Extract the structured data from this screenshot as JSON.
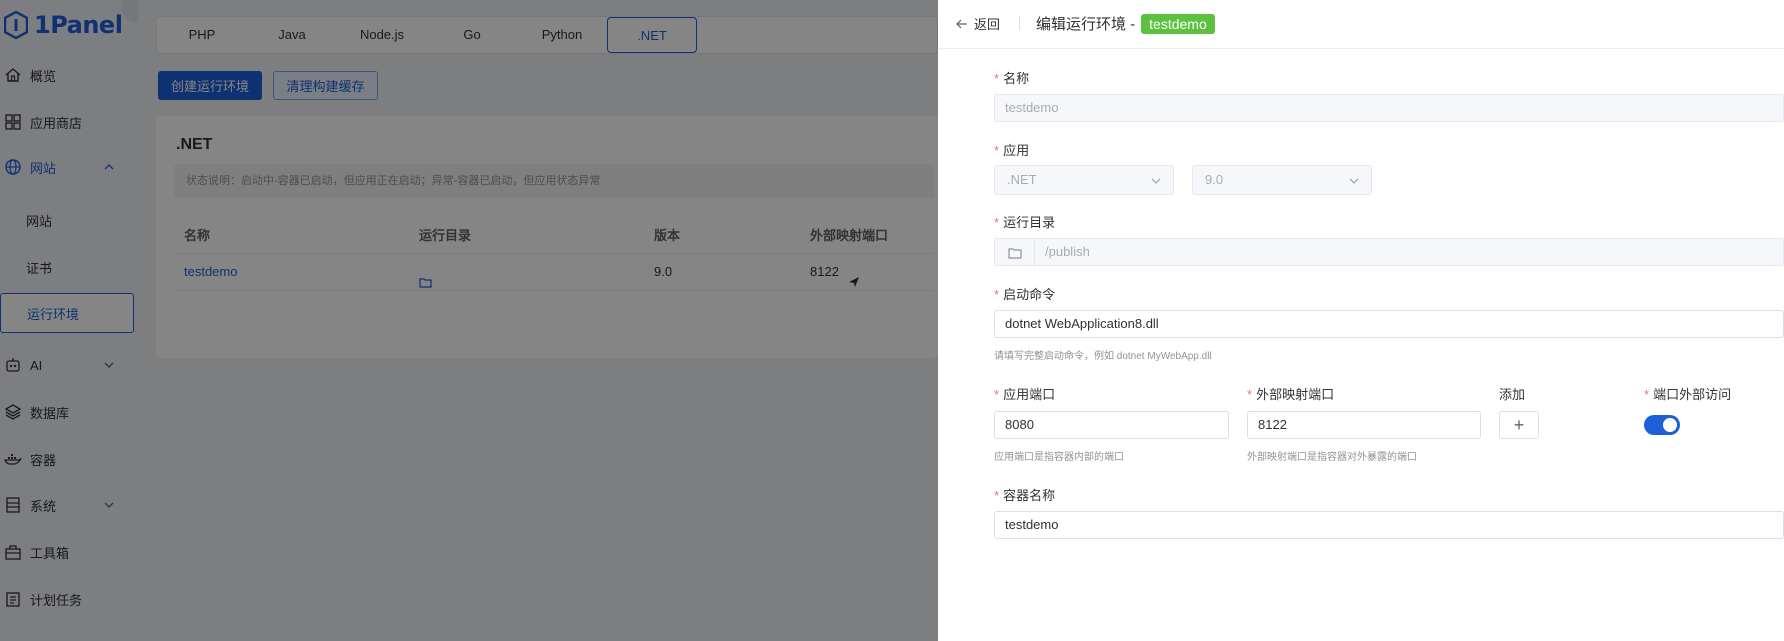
{
  "app": {
    "logo_text": "1Panel"
  },
  "sidebar": {
    "items": [
      {
        "label": "概览",
        "icon": "home-icon"
      },
      {
        "label": "应用商店",
        "icon": "grid-icon"
      },
      {
        "label": "网站",
        "icon": "globe-icon",
        "expanded": true
      },
      {
        "label": "AI",
        "icon": "robot-icon"
      },
      {
        "label": "数据库",
        "icon": "layers-icon"
      },
      {
        "label": "容器",
        "icon": "docker-icon"
      },
      {
        "label": "系统",
        "icon": "server-icon"
      },
      {
        "label": "工具箱",
        "icon": "toolbox-icon"
      },
      {
        "label": "计划任务",
        "icon": "calendar-icon"
      }
    ],
    "subitems": [
      {
        "label": "网站"
      },
      {
        "label": "证书"
      },
      {
        "label": "运行环境",
        "selected": true
      }
    ]
  },
  "tabs": [
    {
      "label": "PHP"
    },
    {
      "label": "Java"
    },
    {
      "label": "Node.js"
    },
    {
      "label": "Go"
    },
    {
      "label": "Python"
    },
    {
      "label": ".NET",
      "active": true
    }
  ],
  "actions": {
    "create_label": "创建运行环境",
    "clear_label": "清理构建缓存"
  },
  "card": {
    "title": ".NET",
    "status_tip": "状态说明：启动中-容器已启动，但应用正在启动；异常-容器已启动，但应用状态异常",
    "columns": [
      "名称",
      "运行目录",
      "版本",
      "外部映射端口"
    ],
    "rows": [
      {
        "name": "testdemo",
        "version": "9.0",
        "port": "8122"
      }
    ]
  },
  "drawer": {
    "back_label": "返回",
    "title": "编辑运行环境 -",
    "title_tag": "testdemo",
    "fields": {
      "name": {
        "label": "名称",
        "value": "testdemo"
      },
      "app": {
        "label": "应用",
        "app_value": ".NET",
        "version_value": "9.0"
      },
      "run_dir": {
        "label": "运行目录",
        "value": "/publish"
      },
      "command": {
        "label": "启动命令",
        "value": "dotnet WebApplication8.dll",
        "help": "请填写完整启动命令，例如 dotnet MyWebApp.dll"
      },
      "app_port": {
        "label": "应用端口",
        "value": "8080",
        "help": "应用端口是指容器内部的端口"
      },
      "ext_port": {
        "label": "外部映射端口",
        "value": "8122",
        "help": "外部映射端口是指容器对外暴露的端口"
      },
      "add": {
        "label": "添加",
        "button": "+"
      },
      "external_access": {
        "label": "端口外部访问",
        "enabled": true
      },
      "container_name": {
        "label": "容器名称",
        "value": "testdemo"
      }
    }
  },
  "colors": {
    "primary": "#1e5fd8",
    "tag_green": "#5bc13f",
    "required": "#f56c6c"
  }
}
